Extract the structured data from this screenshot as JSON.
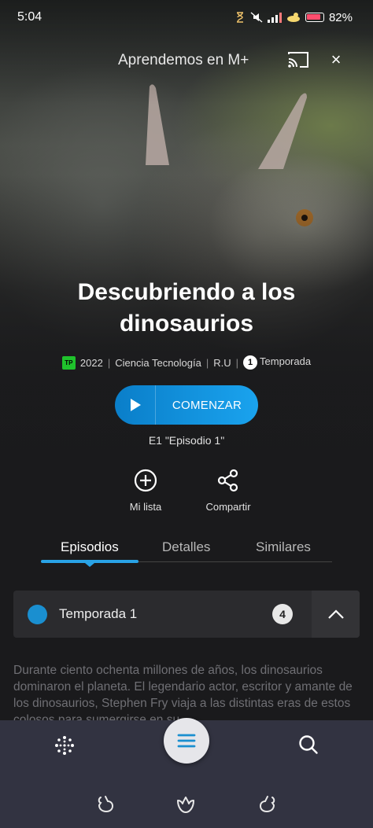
{
  "status_bar": {
    "time": "5:04",
    "battery": "82%"
  },
  "header": {
    "app_title": "Aprendemos en M+",
    "close_label": "×"
  },
  "show": {
    "title": "Descubriendo a los dinosaurios",
    "rating_badge": "TP",
    "year": "2022",
    "genres": "Ciencia Tecnología",
    "country": "R.U",
    "seasons_count": "1",
    "seasons_label": "Temporada"
  },
  "actions": {
    "start_label": "COMENZAR",
    "episode_hint": "E1 \"Episodio 1\"",
    "my_list_label": "Mi lista",
    "share_label": "Compartir"
  },
  "tabs": [
    {
      "label": "Episodios",
      "active": true
    },
    {
      "label": "Detalles",
      "active": false
    },
    {
      "label": "Similares",
      "active": false
    }
  ],
  "season_selector": {
    "label": "Temporada 1",
    "episode_count": "4"
  },
  "description": "Durante ciento ochenta millones de años, los dinosaurios dominaron el planeta. El legendario actor, escritor y amante de los dinosaurios, Stephen Fry viaja a las distintas eras de estos colosos para sumergirse en su",
  "colors": {
    "accent": "#29a3e6",
    "button_start": "#0a7ec9",
    "button_end": "#1aa3ee",
    "nav_bg": "#323341",
    "rating_green": "#1fc22c"
  },
  "bottom_nav": {
    "left_icon": "sparkle-icon",
    "center_icon": "menu-icon",
    "right_icon": "search-icon"
  }
}
